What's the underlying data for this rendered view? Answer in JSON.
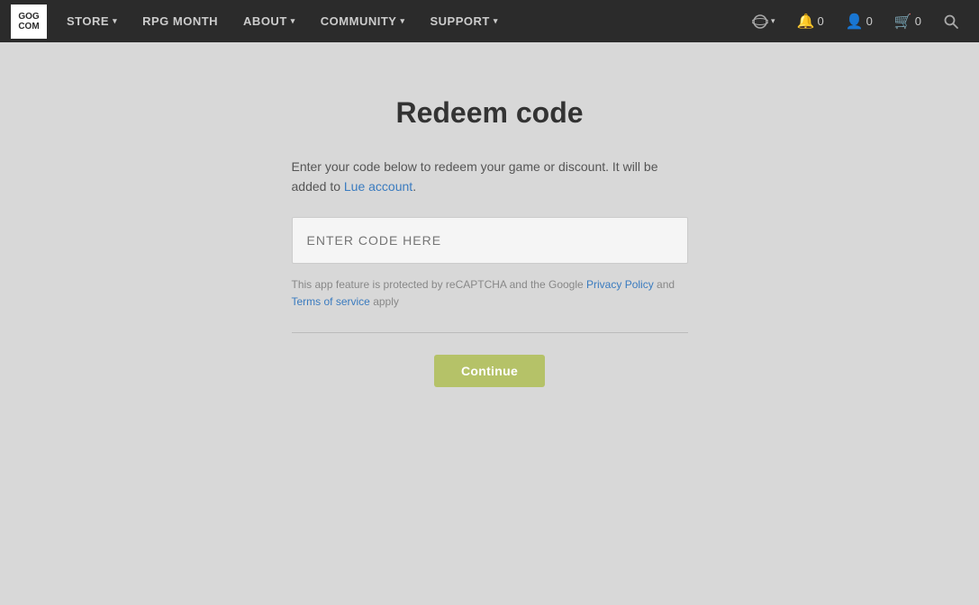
{
  "nav": {
    "logo_line1": "GOG",
    "logo_line2": "COM",
    "items": [
      {
        "label": "STORE",
        "hasDropdown": true
      },
      {
        "label": "RPG MONTH",
        "hasDropdown": false
      },
      {
        "label": "ABOUT",
        "hasDropdown": true
      },
      {
        "label": "COMMUNITY",
        "hasDropdown": true
      },
      {
        "label": "SUPPORT",
        "hasDropdown": true
      }
    ],
    "notifications_count": "0",
    "user_count": "0",
    "cart_count": "0"
  },
  "page": {
    "title": "Redeem code",
    "description_part1": "Enter your code below to redeem your game or discount. It will be added to Lue account.",
    "description_account": "Lue account",
    "code_input_placeholder": "ENTER CODE HERE",
    "recaptcha_text_before": "This app feature is protected by reCAPTCHA and the Google",
    "privacy_policy_label": "Privacy Policy",
    "recaptcha_and": "and",
    "terms_label": "Terms of service",
    "recaptcha_apply": "apply",
    "continue_label": "Continue"
  }
}
